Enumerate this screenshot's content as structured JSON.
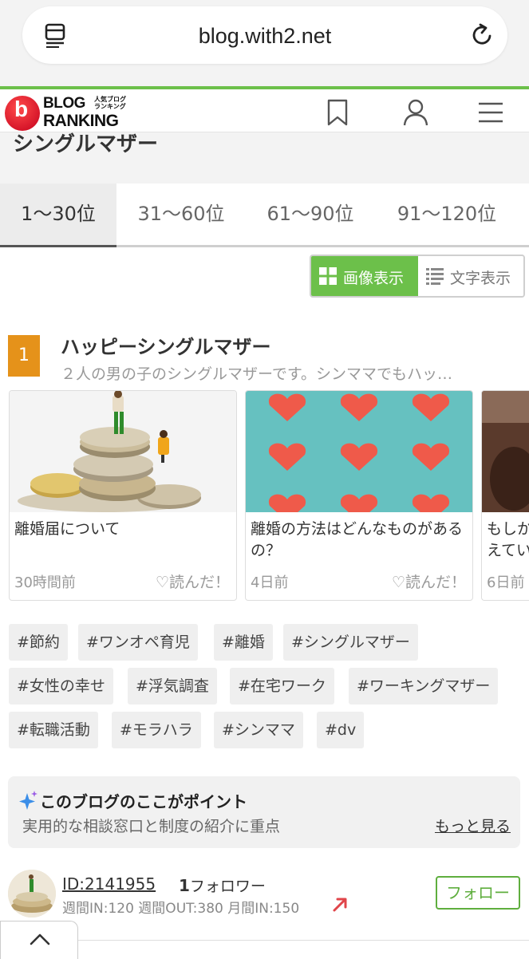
{
  "browser": {
    "url": "blog.with2.net"
  },
  "header": {
    "logo_top": "BLOG",
    "logo_bottom": "RANKING",
    "logo_sub_1": "人気ブログ",
    "logo_sub_2": "ランキング"
  },
  "category": {
    "title": "シングルマザー"
  },
  "rank_tabs": [
    {
      "label": "1〜30位",
      "active": true
    },
    {
      "label": "31〜60位"
    },
    {
      "label": "61〜90位"
    },
    {
      "label": "91〜120位"
    }
  ],
  "view_toggle": {
    "image": "画像表示",
    "text": "文字表示"
  },
  "entry": {
    "rank": "1",
    "title": "ハッピーシングルマザー",
    "description": "２人の男の子のシングルマザーです。シンママでもハッ…"
  },
  "cards": [
    {
      "title": "離婚届について",
      "time": "30時間前",
      "like": "読んだ！"
    },
    {
      "title": "離婚の方法はどんなものがあるの？",
      "time": "4日前",
      "like": "読んだ！"
    },
    {
      "title": "もしかえてい",
      "time": "6日前",
      "like": ""
    }
  ],
  "tags": [
    "#節約",
    "#ワンオペ育児",
    "#離婚",
    "#シングルマザー",
    "#女性の幸せ",
    "#浮気調査",
    "#在宅ワーク",
    "#ワーキングマザー",
    "#転職活動",
    "#モラハラ",
    "#シンママ",
    "#dv"
  ],
  "point": {
    "title": "このブログのここがポイント",
    "body": "実用的な相談窓口と制度の紹介に重点",
    "more": "もっと見る"
  },
  "author": {
    "id": "ID:2141955",
    "follower_count": "1",
    "follower_label": "フォロワー",
    "stats": "週間IN:120  週間OUT:380  月間IN:150",
    "follow_button": "フォロー"
  },
  "colors": {
    "brand_green": "#6cc04a",
    "rank_badge": "#e5921a",
    "logo_red": "#d0021b"
  }
}
